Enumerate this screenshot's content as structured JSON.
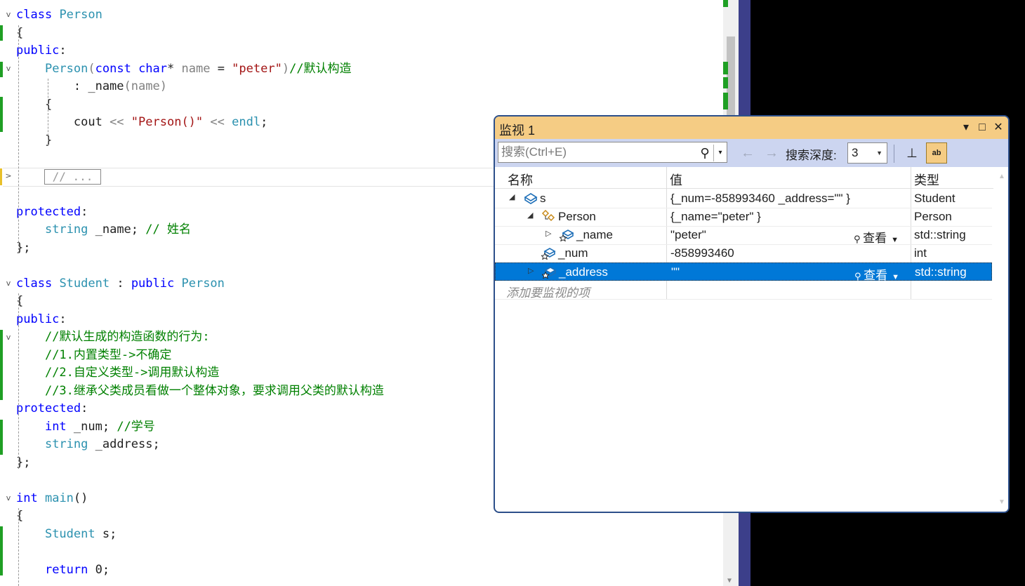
{
  "code": {
    "lines": [
      [
        {
          "t": "class",
          "c": "kw"
        },
        {
          "t": " "
        },
        {
          "t": "Person",
          "c": "ty"
        }
      ],
      [
        {
          "t": "{"
        }
      ],
      [
        {
          "t": "public",
          "c": "kw"
        },
        {
          "t": ":"
        }
      ],
      [
        {
          "t": "    "
        },
        {
          "t": "Person",
          "c": "ty"
        },
        {
          "t": "(",
          "c": "pm"
        },
        {
          "t": "const",
          "c": "kw"
        },
        {
          "t": " "
        },
        {
          "t": "char",
          "c": "kw"
        },
        {
          "t": "* "
        },
        {
          "t": "name",
          "c": "pm"
        },
        {
          "t": " = "
        },
        {
          "t": "\"peter\"",
          "c": "st"
        },
        {
          "t": ")",
          "c": "pm"
        },
        {
          "t": "//默认构造",
          "c": "cm"
        }
      ],
      [
        {
          "t": "        : _name"
        },
        {
          "t": "(name)",
          "c": "pm"
        }
      ],
      [
        {
          "t": "    {"
        }
      ],
      [
        {
          "t": "        cout "
        },
        {
          "t": "<<",
          "c": "pm"
        },
        {
          "t": " "
        },
        {
          "t": "\"Person()\"",
          "c": "st"
        },
        {
          "t": " "
        },
        {
          "t": "<<",
          "c": "pm"
        },
        {
          "t": " "
        },
        {
          "t": "endl",
          "c": "ty"
        },
        {
          "t": ";"
        }
      ],
      [
        {
          "t": "    }"
        }
      ],
      [
        {
          "t": ""
        }
      ],
      [
        {
          "t": ""
        }
      ],
      [
        {
          "t": ""
        }
      ],
      [
        {
          "t": "protected",
          "c": "kw"
        },
        {
          "t": ":"
        }
      ],
      [
        {
          "t": "    "
        },
        {
          "t": "string",
          "c": "ty"
        },
        {
          "t": " _name; "
        },
        {
          "t": "// 姓名",
          "c": "cm"
        }
      ],
      [
        {
          "t": "};"
        }
      ],
      [
        {
          "t": ""
        }
      ],
      [
        {
          "t": "class",
          "c": "kw"
        },
        {
          "t": " "
        },
        {
          "t": "Student",
          "c": "ty"
        },
        {
          "t": " : "
        },
        {
          "t": "public",
          "c": "kw"
        },
        {
          "t": " "
        },
        {
          "t": "Person",
          "c": "ty"
        }
      ],
      [
        {
          "t": "{"
        }
      ],
      [
        {
          "t": "public",
          "c": "kw"
        },
        {
          "t": ":"
        }
      ],
      [
        {
          "t": "    "
        },
        {
          "t": "//默认生成的构造函数的行为:",
          "c": "cm"
        }
      ],
      [
        {
          "t": "    "
        },
        {
          "t": "//1.内置类型->不确定",
          "c": "cm"
        }
      ],
      [
        {
          "t": "    "
        },
        {
          "t": "//2.自定义类型->调用默认构造",
          "c": "cm"
        }
      ],
      [
        {
          "t": "    "
        },
        {
          "t": "//3.继承父类成员看做一个整体对象，要求调用父类的默认构造",
          "c": "cm"
        }
      ],
      [
        {
          "t": "protected",
          "c": "kw"
        },
        {
          "t": ":"
        }
      ],
      [
        {
          "t": "    "
        },
        {
          "t": "int",
          "c": "kw"
        },
        {
          "t": " _num; "
        },
        {
          "t": "//学号",
          "c": "cm"
        }
      ],
      [
        {
          "t": "    "
        },
        {
          "t": "string",
          "c": "ty"
        },
        {
          "t": " _address;"
        }
      ],
      [
        {
          "t": "};"
        }
      ],
      [
        {
          "t": ""
        }
      ],
      [
        {
          "t": "int",
          "c": "kw"
        },
        {
          "t": " "
        },
        {
          "t": "main",
          "c": "ty"
        },
        {
          "t": "()"
        }
      ],
      [
        {
          "t": "{"
        }
      ],
      [
        {
          "t": "    "
        },
        {
          "t": "Student",
          "c": "ty"
        },
        {
          "t": " s;"
        }
      ],
      [
        {
          "t": ""
        }
      ],
      [
        {
          "t": "    "
        },
        {
          "t": "return",
          "c": "kw"
        },
        {
          "t": " 0;"
        }
      ]
    ],
    "collapsed_text": "// ...",
    "fold_glyph": "v",
    "collapsed_glyph": ">"
  },
  "watch": {
    "title": "监视 1",
    "search_placeholder": "搜索(Ctrl+E)",
    "depth_label": "搜索深度:",
    "depth_value": "3",
    "columns": [
      "名称",
      "值",
      "类型"
    ],
    "rows": [
      {
        "name": "s",
        "value": "{_num=-858993460 _address=\"\" }",
        "type": "Student",
        "expander": "◢",
        "icon": "object-icon",
        "level": 0
      },
      {
        "name": "Person",
        "value": "{_name=\"peter\" }",
        "type": "Person",
        "expander": "◢",
        "icon": "class-icon",
        "level": 1
      },
      {
        "name": "_name",
        "value": "\"peter\"",
        "type": "std::string",
        "expander": "▷",
        "icon": "protected-field-icon",
        "level": 2,
        "view": "查看"
      },
      {
        "name": "_num",
        "value": "-858993460",
        "type": "int",
        "expander": "",
        "icon": "protected-field-icon",
        "level": 1
      },
      {
        "name": "_address",
        "value": "\"\"",
        "type": "std::string",
        "expander": "▷",
        "icon": "protected-field-icon",
        "level": 1,
        "view": "查看",
        "selected": true
      }
    ],
    "add_hint": "添加要监视的项"
  },
  "icons": {
    "dropdown": "▾",
    "maximize": "□",
    "close": "✕",
    "search": "⚲",
    "back": "←",
    "forward": "→",
    "pin": "⊥",
    "hex": "ab",
    "magnifier": "🔍"
  },
  "colors": {
    "keyword": "#0000ff",
    "type": "#2b91af",
    "comment": "#008000",
    "string": "#a31515",
    "watch_title_bg": "#f5cc84",
    "watch_toolbar_bg": "#ccd5f0",
    "selection": "#0078d7",
    "change_marker": "#1f9f24"
  }
}
